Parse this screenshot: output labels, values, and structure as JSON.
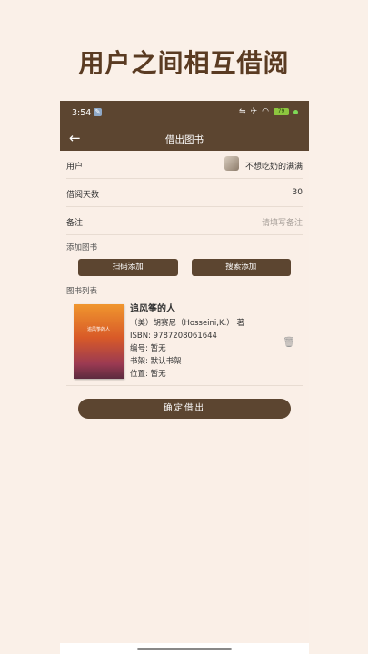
{
  "headline": "用户之间相互借阅",
  "status_bar": {
    "time": "3:54",
    "battery": "79"
  },
  "appbar": {
    "title": "借出图书"
  },
  "form": {
    "user_label": "用户",
    "user_value": "不想吃奶的满满",
    "days_label": "借阅天数",
    "days_value": "30",
    "note_label": "备注",
    "note_placeholder": "请填写备注"
  },
  "add_book": {
    "section_label": "添加图书",
    "scan_label": "扫码添加",
    "search_label": "搜索添加"
  },
  "book_list": {
    "section_label": "图书列表",
    "books": [
      {
        "title": "追风筝的人",
        "author": "（美）胡赛尼（Hosseini,K.） 著",
        "isbn": "ISBN: 9787208061644",
        "number": "编号: 暂无",
        "shelf": "书架: 默认书架",
        "location": "位置: 暂无",
        "cover_text": "追风筝的人"
      }
    ]
  },
  "confirm_label": "确定借出"
}
